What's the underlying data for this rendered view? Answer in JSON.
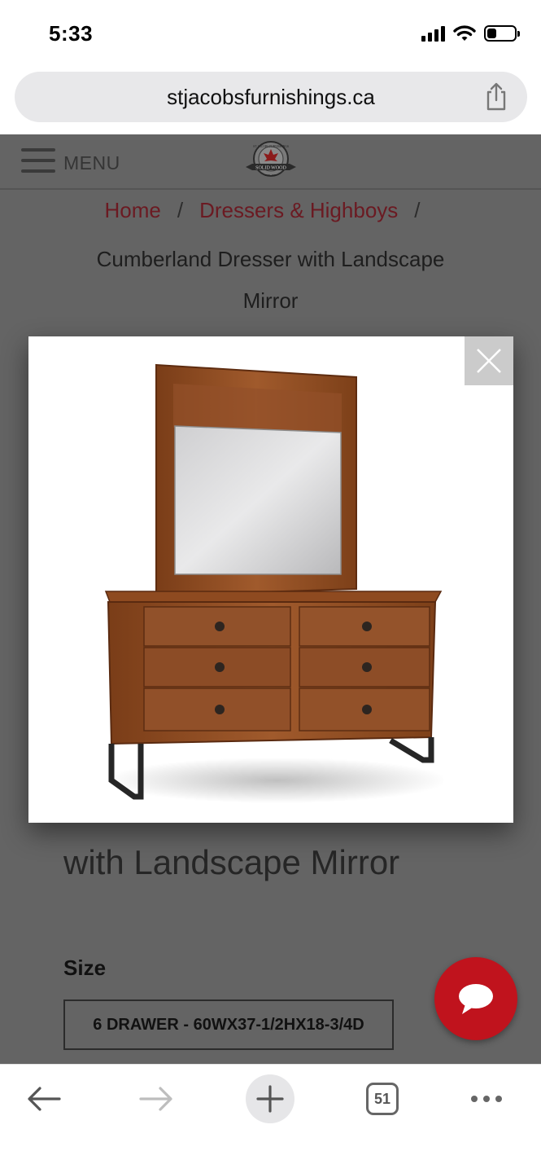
{
  "status_bar": {
    "time": "5:33",
    "battery_level": 0.35
  },
  "browser": {
    "url": "stjacobsfurnishings.ca",
    "tab_count": "51",
    "icons": [
      "back-arrow-icon",
      "forward-arrow-icon",
      "plus-icon",
      "tabs-icon",
      "more-icon",
      "share-icon"
    ]
  },
  "header": {
    "menu_label": "MENU",
    "logo": {
      "text_top": "ST. JACOBS FURNISHINGS",
      "text_banner": "SOLID WOOD",
      "text_bottom": "EST. 1987"
    }
  },
  "breadcrumb": {
    "items": [
      {
        "label": "Home"
      },
      {
        "label": "Dressers & Highboys"
      }
    ],
    "separator": "/",
    "current": "Cumberland Dresser with Landscape Mirror"
  },
  "product": {
    "title_visible": "with Landscape Mirror",
    "size_label": "Size",
    "size_selected": "6 DRAWER - 60WX37-1/2HX18-3/4D"
  },
  "lightbox": {
    "close_icon": "close-icon",
    "image": "dresser-with-mirror"
  },
  "colors": {
    "overlay_page": "#646464",
    "breadcrumb_link": "#6b1a22",
    "chat_button": "#c0131d",
    "wood": "#8a4a22"
  }
}
